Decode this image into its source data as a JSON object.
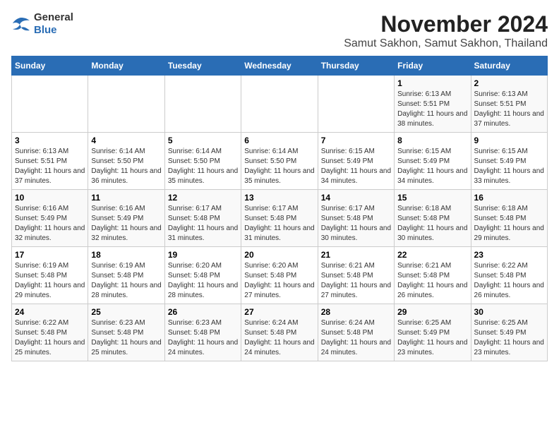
{
  "logo": {
    "text_general": "General",
    "text_blue": "Blue"
  },
  "title": "November 2024",
  "subtitle": "Samut Sakhon, Samut Sakhon, Thailand",
  "headers": [
    "Sunday",
    "Monday",
    "Tuesday",
    "Wednesday",
    "Thursday",
    "Friday",
    "Saturday"
  ],
  "weeks": [
    [
      {
        "day": "",
        "info": ""
      },
      {
        "day": "",
        "info": ""
      },
      {
        "day": "",
        "info": ""
      },
      {
        "day": "",
        "info": ""
      },
      {
        "day": "",
        "info": ""
      },
      {
        "day": "1",
        "info": "Sunrise: 6:13 AM\nSunset: 5:51 PM\nDaylight: 11 hours and 38 minutes."
      },
      {
        "day": "2",
        "info": "Sunrise: 6:13 AM\nSunset: 5:51 PM\nDaylight: 11 hours and 37 minutes."
      }
    ],
    [
      {
        "day": "3",
        "info": "Sunrise: 6:13 AM\nSunset: 5:51 PM\nDaylight: 11 hours and 37 minutes."
      },
      {
        "day": "4",
        "info": "Sunrise: 6:14 AM\nSunset: 5:50 PM\nDaylight: 11 hours and 36 minutes."
      },
      {
        "day": "5",
        "info": "Sunrise: 6:14 AM\nSunset: 5:50 PM\nDaylight: 11 hours and 35 minutes."
      },
      {
        "day": "6",
        "info": "Sunrise: 6:14 AM\nSunset: 5:50 PM\nDaylight: 11 hours and 35 minutes."
      },
      {
        "day": "7",
        "info": "Sunrise: 6:15 AM\nSunset: 5:49 PM\nDaylight: 11 hours and 34 minutes."
      },
      {
        "day": "8",
        "info": "Sunrise: 6:15 AM\nSunset: 5:49 PM\nDaylight: 11 hours and 34 minutes."
      },
      {
        "day": "9",
        "info": "Sunrise: 6:15 AM\nSunset: 5:49 PM\nDaylight: 11 hours and 33 minutes."
      }
    ],
    [
      {
        "day": "10",
        "info": "Sunrise: 6:16 AM\nSunset: 5:49 PM\nDaylight: 11 hours and 32 minutes."
      },
      {
        "day": "11",
        "info": "Sunrise: 6:16 AM\nSunset: 5:49 PM\nDaylight: 11 hours and 32 minutes."
      },
      {
        "day": "12",
        "info": "Sunrise: 6:17 AM\nSunset: 5:48 PM\nDaylight: 11 hours and 31 minutes."
      },
      {
        "day": "13",
        "info": "Sunrise: 6:17 AM\nSunset: 5:48 PM\nDaylight: 11 hours and 31 minutes."
      },
      {
        "day": "14",
        "info": "Sunrise: 6:17 AM\nSunset: 5:48 PM\nDaylight: 11 hours and 30 minutes."
      },
      {
        "day": "15",
        "info": "Sunrise: 6:18 AM\nSunset: 5:48 PM\nDaylight: 11 hours and 30 minutes."
      },
      {
        "day": "16",
        "info": "Sunrise: 6:18 AM\nSunset: 5:48 PM\nDaylight: 11 hours and 29 minutes."
      }
    ],
    [
      {
        "day": "17",
        "info": "Sunrise: 6:19 AM\nSunset: 5:48 PM\nDaylight: 11 hours and 29 minutes."
      },
      {
        "day": "18",
        "info": "Sunrise: 6:19 AM\nSunset: 5:48 PM\nDaylight: 11 hours and 28 minutes."
      },
      {
        "day": "19",
        "info": "Sunrise: 6:20 AM\nSunset: 5:48 PM\nDaylight: 11 hours and 28 minutes."
      },
      {
        "day": "20",
        "info": "Sunrise: 6:20 AM\nSunset: 5:48 PM\nDaylight: 11 hours and 27 minutes."
      },
      {
        "day": "21",
        "info": "Sunrise: 6:21 AM\nSunset: 5:48 PM\nDaylight: 11 hours and 27 minutes."
      },
      {
        "day": "22",
        "info": "Sunrise: 6:21 AM\nSunset: 5:48 PM\nDaylight: 11 hours and 26 minutes."
      },
      {
        "day": "23",
        "info": "Sunrise: 6:22 AM\nSunset: 5:48 PM\nDaylight: 11 hours and 26 minutes."
      }
    ],
    [
      {
        "day": "24",
        "info": "Sunrise: 6:22 AM\nSunset: 5:48 PM\nDaylight: 11 hours and 25 minutes."
      },
      {
        "day": "25",
        "info": "Sunrise: 6:23 AM\nSunset: 5:48 PM\nDaylight: 11 hours and 25 minutes."
      },
      {
        "day": "26",
        "info": "Sunrise: 6:23 AM\nSunset: 5:48 PM\nDaylight: 11 hours and 24 minutes."
      },
      {
        "day": "27",
        "info": "Sunrise: 6:24 AM\nSunset: 5:48 PM\nDaylight: 11 hours and 24 minutes."
      },
      {
        "day": "28",
        "info": "Sunrise: 6:24 AM\nSunset: 5:48 PM\nDaylight: 11 hours and 24 minutes."
      },
      {
        "day": "29",
        "info": "Sunrise: 6:25 AM\nSunset: 5:49 PM\nDaylight: 11 hours and 23 minutes."
      },
      {
        "day": "30",
        "info": "Sunrise: 6:25 AM\nSunset: 5:49 PM\nDaylight: 11 hours and 23 minutes."
      }
    ]
  ]
}
